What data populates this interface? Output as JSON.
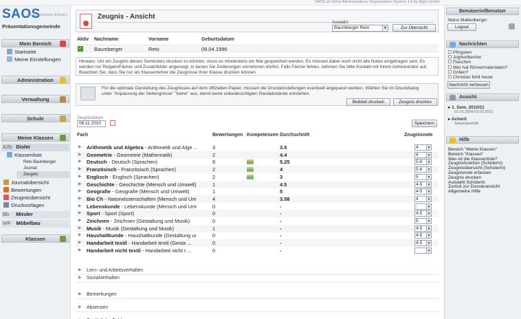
{
  "system_title": "SAOS.ch Schul-Administrations-Organisations-System 1.0 by digiro GmbH",
  "left": {
    "logo": "SAOS",
    "logo_sub": "Schulverwaltung Software",
    "school": "Präsentationsgemeinde",
    "mein_bereich": "Mein Bereich",
    "startseite": "Startseite",
    "einstellungen": "Meine Einstellungen",
    "administration": "Administration",
    "verwaltung": "Verwaltung",
    "schule": "Schule",
    "meine_klassen": "Meine Klassen",
    "class_code": "A2b",
    "class_name": "Disler",
    "klassenliste": "Klassenliste",
    "student": "Reto Baumberger",
    "journal": "Journal",
    "zeugnis": "Zeugnis",
    "journaluebersicht": "Journalübersicht",
    "bewertungen": "Bewertungen",
    "zeugnisuebersicht": "Zeugnisübersicht",
    "druckvorlagen": "Druckvorlagen",
    "bb_code": "Bb",
    "bb_name": "Minder",
    "wf_code": "WF",
    "wf_name": "Möbelbau",
    "klassen": "Klassen"
  },
  "header": {
    "title": "Zeugnis - Ansicht",
    "auswahl_label": "Auswahl:",
    "auswahl_value": "Baumberger Reto",
    "back_button": "Zur Übersicht"
  },
  "student_table": {
    "headers": [
      "Aktiv",
      "Nachname",
      "Vorname",
      "Geburtsdatum"
    ],
    "row": {
      "nachname": "Baumberger",
      "vorname": "Reto",
      "geburtsdatum": "09.04.1996"
    }
  },
  "hint": "Hinweis: Um ein Zeugnis dieses Semesters drucken zu können, muss es mindestens ein Mal gespeichert werden. Es müssen dabei noch nicht alle Noten eingetragen sein. Es werden nur Reigeln/Fächer und Zusatzfelder angezeigt, in denen Sie Änderungen vornehmen dürfen. Falls Fächer fehlen, nehmen Sie bitte Kontakt mit Ihrem Administrator auf. Beachten Sie, dass Sie nur als Klassenlehrer die Zeugnisse Ihrer Klasse drucken können.",
  "print_info": "Für die optimale Darstellung des Zeugnisses auf dem offiziellen Papier, müssen die Druckeinstellungen eventuell angepasst werden. Wählen Sie im Druckdialog unter \"Anpassung der Seitengrösse\" \"keine\" aus, damit keine unbeabsichtigten Randabstände entstehen.",
  "buttons": {
    "beiblatt": "Beiblatt drucken",
    "zeugnis": "Zeugnis drucken",
    "speichern": "Speichern"
  },
  "zeugnisdatum_label": "Zeugnisdatum",
  "zeugnisdatum_value": "08.11.2010",
  "grades_headers": {
    "fach": "Fach",
    "bewertungen": "Bewertungen",
    "kompetenzen": "Kompetenzen",
    "durchschnitt": "Durchschnitt",
    "zeugnisnote": "Zeugnisnote"
  },
  "subjects": [
    {
      "name": "Arithmetik und Algebra",
      "detail": " - Arithmetik und Alge ...",
      "bew": "3",
      "komp": false,
      "avg": "3.5",
      "note": "4"
    },
    {
      "name": "Geometrie",
      "detail": " - Geometrie (Mathematik)",
      "bew": "2",
      "komp": false,
      "avg": "4.4",
      "note": "4"
    },
    {
      "name": "Deutsch",
      "detail": " - Deutsch (Sprachen)",
      "bew": "9",
      "komp": true,
      "avg": "5.25",
      "note": "5-6"
    },
    {
      "name": "Französisch",
      "detail": " - Französisch (Sprachen)",
      "bew": "2",
      "komp": true,
      "avg": "4",
      "note": "5-6"
    },
    {
      "name": "Englisch",
      "detail": " - Englisch (Sprachen)",
      "bew": "2",
      "komp": true,
      "avg": "3",
      "note": "5"
    },
    {
      "name": "Geschichte",
      "detail": " - Geschichte (Mensch und Umwelt)",
      "bew": "1",
      "komp": false,
      "avg": "4.5",
      "note": "4-5"
    },
    {
      "name": "Geografie",
      "detail": " - Geografie (Mensch und Umwelt)",
      "bew": "1",
      "komp": false,
      "avg": "5",
      "note": "4-5"
    },
    {
      "name": "Bio Ch",
      "detail": " - Naturwissenschaften (Mensch und Um ...",
      "bew": "4",
      "komp": false,
      "avg": "3.58",
      "note": "4"
    },
    {
      "name": "Lebenskunde",
      "detail": " - Lebenskunde (Mensch und Umwelt)",
      "bew": "0",
      "komp": false,
      "avg": "-",
      "note": "-"
    },
    {
      "name": "Sport",
      "detail": " - Sport (Sport)",
      "bew": "0",
      "komp": false,
      "avg": "-",
      "note": "4-5"
    },
    {
      "name": "Zeichnen",
      "detail": " - Zeichnen (Gestaltung und Musik)",
      "bew": "0",
      "komp": false,
      "avg": "-",
      "note": "5"
    },
    {
      "name": "Musik",
      "detail": " - Musik (Gestaltung und Musik)",
      "bew": "1",
      "komp": false,
      "avg": "-",
      "note": "4-5"
    },
    {
      "name": "Haushaltkunde",
      "detail": " - Haushaltkunde (Gestaltung un ...",
      "bew": "0",
      "komp": false,
      "avg": "-",
      "note": "4-5"
    },
    {
      "name": "Handarbeit textil",
      "detail": " - Handarbeit textil (Gesta ...",
      "bew": "0",
      "komp": false,
      "avg": "-",
      "note": "4-5"
    },
    {
      "name": "Handarbeit nicht textil",
      "detail": " - Handarbeit nicht t ...",
      "bew": "0",
      "komp": false,
      "avg": "-",
      "note": ""
    }
  ],
  "sections": [
    "Lern- und Arbeitsverhalten",
    "Sozialverhalten",
    "Bemerkungen",
    "Absenzen",
    "Zusätzliche Felder"
  ],
  "right": {
    "benutzerin": "Benutzerin/Benutzer",
    "user_name": "Manu Mattenberger",
    "logout": "Logout",
    "nachrichten": "Nachrichten",
    "messages": [
      "Pfingsten",
      "Joghurtbecher",
      "Flaschen",
      "Wer hat Römermaterialien?",
      "Grillen?",
      "Christian fehlt heute"
    ],
    "verfassen": "Nachricht verfassen",
    "ansicht": "Ansicht",
    "semester": "1. Sem. 2010/11",
    "semester_dates": "01.01.2009-03.02.2011",
    "school_unit": "Acherli",
    "school_level": "Sekundarstufe",
    "hilfe": "Hilfe",
    "help_links": [
      "Bereich \"Meine Klassen\"",
      "Bereich \"Klassen\"",
      "Was ist die Klassenliste?",
      "Zeugnisfunktion (SchülerIn)",
      "Zeugnisübersicht (SchülerIn)",
      "Zeugnisnote erfassen",
      "Zeugnis drucken",
      "Auswahl SchülerIn",
      "Zurück zur Dossieransicht",
      "Allgemeine Hilfe"
    ]
  }
}
